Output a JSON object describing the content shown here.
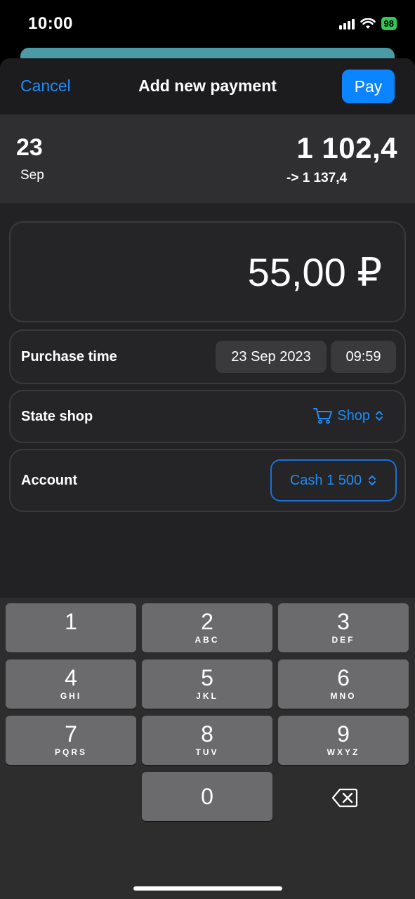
{
  "status_bar": {
    "time": "10:00",
    "battery": "98",
    "icons": [
      "signal-icon",
      "wifi-icon",
      "battery-icon"
    ]
  },
  "nav": {
    "cancel_label": "Cancel",
    "title": "Add new payment",
    "pay_label": "Pay"
  },
  "summary": {
    "day": "23",
    "month": "Sep",
    "balance": "1 102,4",
    "balance_after": "-> 1 137,4"
  },
  "amount": {
    "value": "55,00 ₽"
  },
  "purchase_time": {
    "label": "Purchase time",
    "date": "23 Sep 2023",
    "time": "09:59"
  },
  "shop": {
    "label": "State shop",
    "value": "Shop",
    "icon": "cart-icon"
  },
  "account": {
    "label": "Account",
    "value": "Cash 1 500"
  },
  "keypad": {
    "keys": [
      {
        "num": "1",
        "letters": ""
      },
      {
        "num": "2",
        "letters": "ABC"
      },
      {
        "num": "3",
        "letters": "DEF"
      },
      {
        "num": "4",
        "letters": "GHI"
      },
      {
        "num": "5",
        "letters": "JKL"
      },
      {
        "num": "6",
        "letters": "MNO"
      },
      {
        "num": "7",
        "letters": "PQRS"
      },
      {
        "num": "8",
        "letters": "TUV"
      },
      {
        "num": "9",
        "letters": "WXYZ"
      }
    ],
    "zero": "0",
    "delete_icon": "backspace-icon"
  },
  "colors": {
    "accent": "#1e8cf5",
    "pay_button": "#0a84ff",
    "battery": "#34c759",
    "sheet_bg": "#222224"
  }
}
